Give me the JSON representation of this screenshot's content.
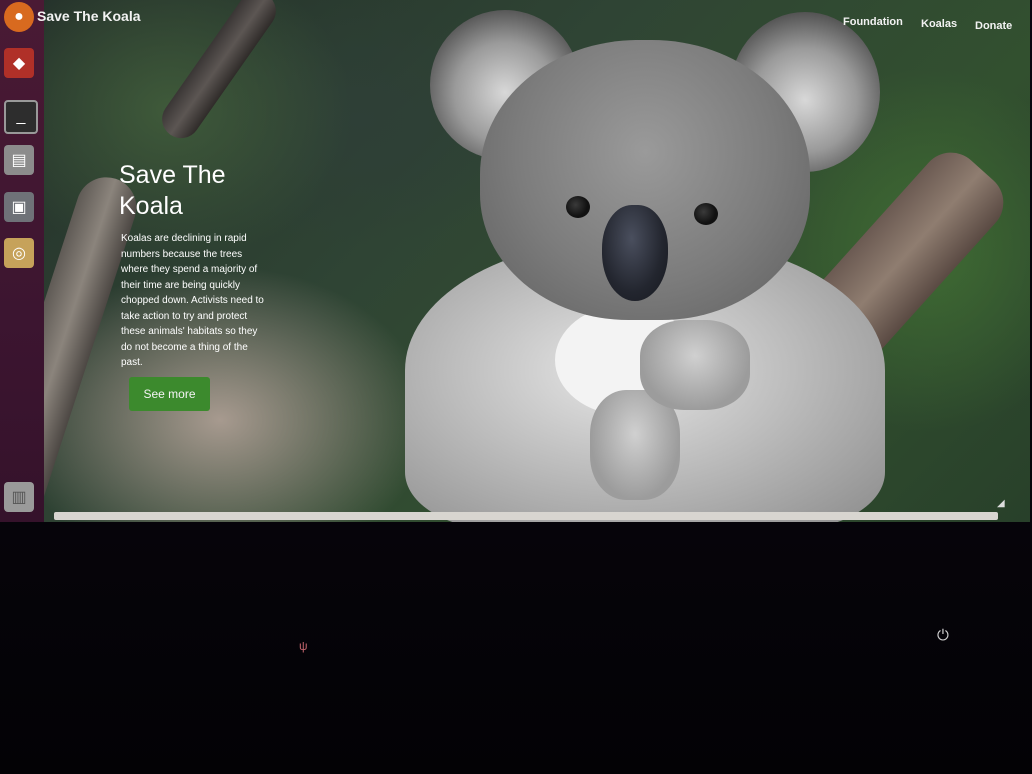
{
  "site": {
    "brand": "Save The Koala",
    "nav": [
      "Foundation",
      "Koalas",
      "Donate"
    ]
  },
  "hero": {
    "title": "Save The Koala",
    "body": "Koalas are declining in rapid numbers because the trees where they spend a majority of their time are being quickly chopped down. Activists need to take action to try and protect these animals' habitats so they do not become a thing of the past.",
    "button": "See more"
  },
  "launcher": {
    "icons": [
      "browser-icon",
      "apps-icon",
      "terminal-icon",
      "files-icon",
      "printer-icon",
      "image-viewer-icon",
      "trash-icon"
    ]
  },
  "colors": {
    "button_green": "#3c8a2d",
    "launcher": "#4a1a34"
  }
}
